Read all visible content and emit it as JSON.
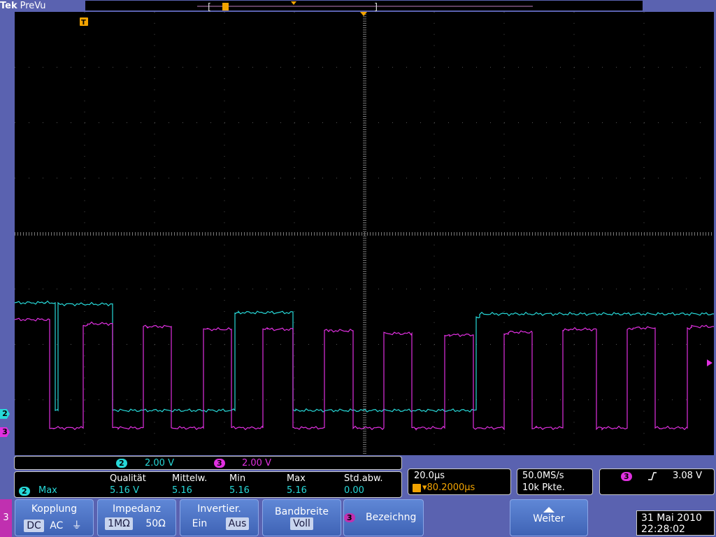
{
  "brand": {
    "tek": "Tek",
    "mode": "PreVu"
  },
  "channels": [
    {
      "id": "2",
      "color": "#27d8d8",
      "scale": "2.00 V"
    },
    {
      "id": "3",
      "color": "#e030e0",
      "scale": "2.00 V"
    }
  ],
  "trigger_marker": "T",
  "left_tab": "3",
  "measurement": {
    "source_badge": "2",
    "name": "Max",
    "headers": [
      "Qualität",
      "Mittelw.",
      "Min",
      "Max",
      "Std.abw."
    ],
    "values": [
      "5.16 V",
      "5.16",
      "5.16",
      "5.16",
      "0.00"
    ]
  },
  "horizontal": {
    "timebase": "20.0µs",
    "trigger_pos": "▾80.2000µs"
  },
  "acquisition": {
    "rate": "50.0MS/s",
    "points": "10k Pkte."
  },
  "trigger": {
    "channel": "3",
    "slope_icon": "rising-edge",
    "level": "3.08 V"
  },
  "buttons": {
    "kopplung": {
      "title": "Kopplung",
      "opts": [
        "DC",
        "AC",
        "⏚"
      ]
    },
    "impedanz": {
      "title": "Impedanz",
      "opts": [
        "1MΩ",
        "50Ω"
      ]
    },
    "invertier": {
      "title": "Invertier.",
      "opts": [
        "Ein",
        "Aus"
      ]
    },
    "bandbreite": {
      "title": "Bandbreite",
      "value": "Voll"
    },
    "bezeichng": {
      "badge": "3",
      "title": "Bezeichng"
    },
    "weiter": {
      "title": "Weiter"
    }
  },
  "datetime": {
    "date": "31 Mai 2010",
    "time": "22:28:02"
  },
  "colors": {
    "cyan": "#27d8d8",
    "magenta": "#e030e0",
    "amber": "#f2a300",
    "bezel": "#5a62b0"
  }
}
